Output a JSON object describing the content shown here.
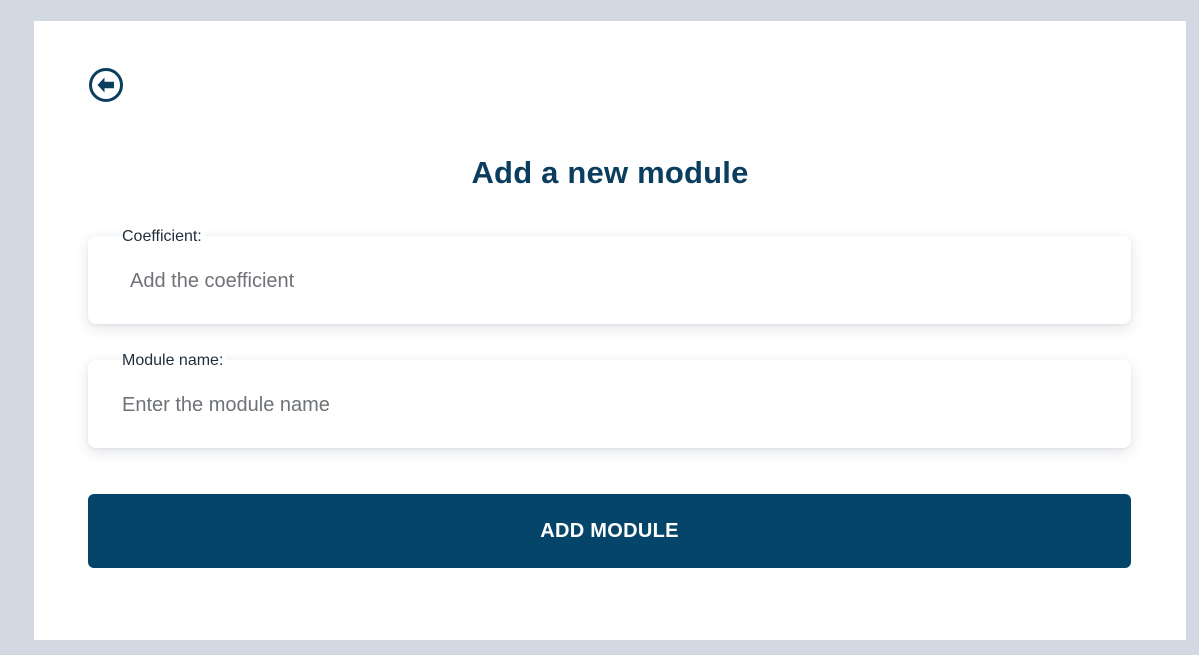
{
  "page": {
    "title": "Add a new module",
    "back_icon": "arrow-left-circle-icon"
  },
  "form": {
    "coefficient": {
      "label": "Coefficient:",
      "placeholder": "Add the coefficient",
      "value": ""
    },
    "module_name": {
      "label": "Module name:",
      "placeholder": "Enter the module name",
      "value": ""
    },
    "submit_label": "ADD MODULE"
  },
  "colors": {
    "page_background": "#d3d9e2",
    "card_background": "#ffffff",
    "primary": "#06456a",
    "title_text": "#0a3d5e"
  }
}
